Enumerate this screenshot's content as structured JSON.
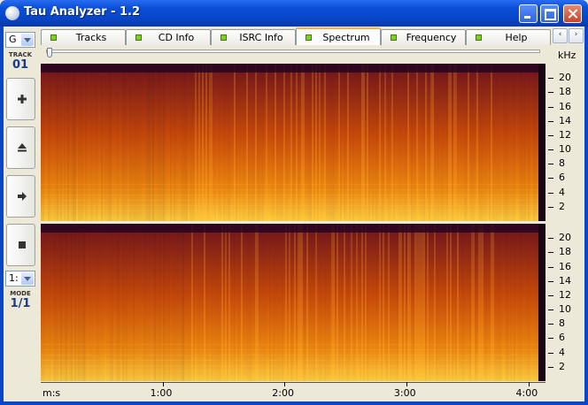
{
  "window": {
    "title": "Tau Analyzer - 1.2"
  },
  "left_panel": {
    "channel_select": "G",
    "track_label": "TRACK",
    "track_value": "01",
    "mode_select": "1:",
    "mode_label": "MODE",
    "mode_value": "1/1",
    "buttons": [
      {
        "name": "add",
        "glyph": "+"
      },
      {
        "name": "eject",
        "glyph": "⏏"
      },
      {
        "name": "play",
        "glyph": "►"
      },
      {
        "name": "stop",
        "glyph": "■"
      }
    ]
  },
  "tabs": [
    {
      "label": "Tracks",
      "active": false
    },
    {
      "label": "CD Info",
      "active": false
    },
    {
      "label": "ISRC Info",
      "active": false
    },
    {
      "label": "Spectrum",
      "active": true
    },
    {
      "label": "Frequency",
      "active": false
    },
    {
      "label": "Help",
      "active": false
    }
  ],
  "tab_scroll": {
    "left": "‹",
    "right": "›"
  },
  "slider": {
    "position": 0
  },
  "chart_data": {
    "type": "heatmap",
    "ylabel": "kHz",
    "xlabel": "m:s",
    "y_ticks": [
      "20",
      "18",
      "16",
      "14",
      "12",
      "10",
      "8",
      "6",
      "4",
      "2"
    ],
    "x_ticks": [
      "1:00",
      "2:00",
      "3:00",
      "4:00"
    ],
    "ylim": [
      0,
      22
    ],
    "xlim": [
      "0:00",
      "4:05"
    ],
    "channels": 2,
    "colormap": [
      "#2a0620",
      "#7a1a1a",
      "#c84a0a",
      "#f08a10",
      "#ffd040"
    ]
  }
}
